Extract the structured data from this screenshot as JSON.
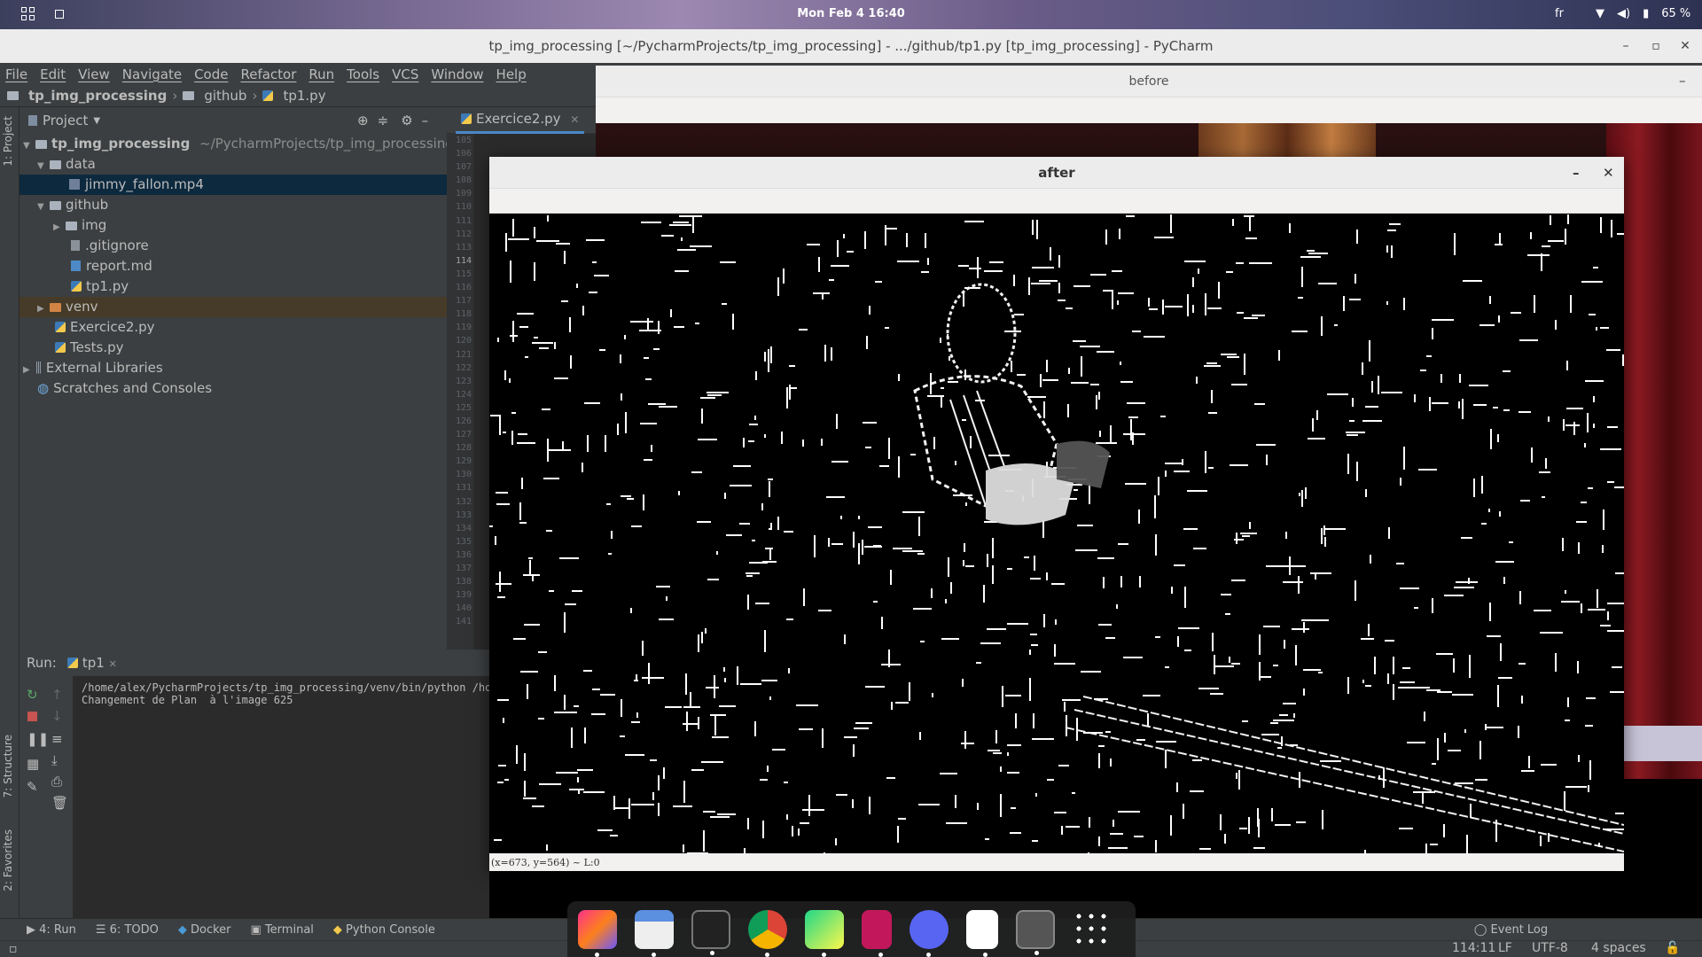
{
  "topbar": {
    "clock": "Mon Feb 4  16:40",
    "language": "fr",
    "battery": "65 %"
  },
  "pycharm": {
    "window_title": "tp_img_processing [~/PycharmProjects/tp_img_processing] - .../github/tp1.py [tp_img_processing] - PyCharm",
    "menu": [
      "File",
      "Edit",
      "View",
      "Navigate",
      "Code",
      "Refactor",
      "Run",
      "Tools",
      "VCS",
      "Window",
      "Help"
    ],
    "breadcrumb": [
      "tp_img_processing",
      "github",
      "tp1.py"
    ],
    "project_panel_title": "Project",
    "tree": {
      "root": "tp_img_processing",
      "root_path": "~/PycharmProjects/tp_img_processing",
      "data": "data",
      "jimmy": "jimmy_fallon.mp4",
      "github": "github",
      "img": "img",
      "gitignore": ".gitignore",
      "report": "report.md",
      "tp1": "tp1.py",
      "venv": "venv",
      "exercice2": "Exercice2.py",
      "tests": "Tests.py",
      "extlibs": "External Libraries",
      "scratches": "Scratches and Consoles"
    },
    "editor_tab": "Exercice2.py",
    "line_numbers": [
      "105",
      "106",
      "107",
      "108",
      "109",
      "110",
      "111",
      "112",
      "113",
      "114",
      "115",
      "116",
      "117",
      "118",
      "119",
      "120",
      "121",
      "122",
      "123",
      "124",
      "125",
      "126",
      "127",
      "128",
      "129",
      "130",
      "131",
      "132",
      "133",
      "134",
      "135",
      "136",
      "137",
      "138",
      "139",
      "140",
      "141"
    ],
    "left_tabs": {
      "project": "1: Project",
      "structure": "7: Structure",
      "favorites": "2: Favorites"
    },
    "run": {
      "label": "Run:",
      "tab": "tp1",
      "console_line1": "/home/alex/PycharmProjects/tp_img_processing/venv/bin/python /home",
      "console_line2": "Changement de Plan  à l'image 625"
    },
    "bottom_tabs": {
      "run": "4: Run",
      "todo": "6: TODO",
      "docker": "Docker",
      "terminal": "Terminal",
      "python_console": "Python Console",
      "event_log": "Event Log"
    },
    "status": {
      "position": "114:11",
      "line_sep": "LF",
      "encoding": "UTF-8",
      "indent": "4 spaces"
    }
  },
  "before_window": {
    "title": "before"
  },
  "after_window": {
    "title": "after",
    "status": "(x=673, y=564) ~ L:0"
  },
  "dock": {
    "apps": [
      "jetbrains-toolbox-icon",
      "files-icon",
      "terminal-icon",
      "chrome-icon",
      "pycharm-icon",
      "text-editor-icon",
      "discord-icon",
      "document-viewer-icon",
      "image-window-icon",
      "app-grid-icon"
    ]
  }
}
